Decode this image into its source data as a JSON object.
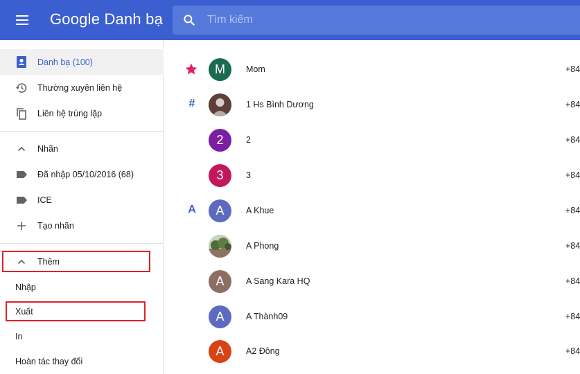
{
  "header": {
    "brand": "Google Danh bạ",
    "search_placeholder": "Tìm kiếm"
  },
  "sidebar": {
    "main_items": [
      {
        "label": "Danh bạ (100)",
        "icon": "contacts-icon",
        "active": true
      },
      {
        "label": "Thường xuyên liên hệ",
        "icon": "history-icon",
        "active": false
      },
      {
        "label": "Liên hệ trùng lặp",
        "icon": "copy-icon",
        "active": false
      }
    ],
    "labels_section": {
      "header": "Nhãn",
      "items": [
        {
          "label": "Đã nhập 05/10/2016 (68)",
          "icon": "label-icon"
        },
        {
          "label": "ICE",
          "icon": "label-icon"
        },
        {
          "label": "Tạo nhãn",
          "icon": "plus-icon"
        }
      ]
    },
    "more_section": {
      "header": "Thêm",
      "items": [
        "Nhập",
        "Xuất",
        "In",
        "Hoàn tác thay đổi"
      ]
    }
  },
  "contacts": [
    {
      "section": "star",
      "initial": "M",
      "color": "#1a6b4f",
      "name": "Mom",
      "phone": "+84"
    },
    {
      "section": "#",
      "initial": "",
      "photo": "person",
      "color": "#6d4c41",
      "name": "1 Hs Bình Dương",
      "phone": "+84"
    },
    {
      "section": "",
      "initial": "2",
      "color": "#7b1fa2",
      "name": "2",
      "phone": "+84"
    },
    {
      "section": "",
      "initial": "3",
      "color": "#c2185b",
      "name": "3",
      "phone": "+84"
    },
    {
      "section": "A",
      "initial": "A",
      "color": "#5c6bc0",
      "name": "A Khue",
      "phone": "+84"
    },
    {
      "section": "",
      "initial": "",
      "photo": "landscape",
      "color": "#7a8a6a",
      "name": "A Phong",
      "phone": "+84"
    },
    {
      "section": "",
      "initial": "A",
      "color": "#8d6e63",
      "name": "A Sang Kara HQ",
      "phone": "+84"
    },
    {
      "section": "",
      "initial": "A",
      "color": "#5c6bc0",
      "name": "A Thành09",
      "phone": "+84"
    },
    {
      "section": "",
      "initial": "A",
      "color": "#d84315",
      "name": "A2 Đông",
      "phone": "+84"
    }
  ],
  "colors": {
    "accent": "#3b5fd0",
    "star": "#e91e63",
    "highlight_box": "#e0202a"
  }
}
